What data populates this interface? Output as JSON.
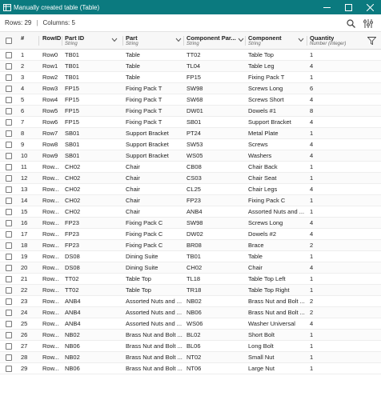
{
  "window": {
    "title": "Manually created table (Table)"
  },
  "toolbar": {
    "rows_label": "Rows: 29",
    "separator": "|",
    "columns_label": "Columns: 5"
  },
  "icons": {
    "app": "table-icon",
    "minimize": "minimize-icon",
    "maximize": "maximize-icon",
    "close": "close-icon",
    "search": "search-icon",
    "settings": "column-settings-icon",
    "filter": "filter-icon"
  },
  "columns": [
    {
      "name": "#",
      "type": ""
    },
    {
      "name": "RowID",
      "type": ""
    },
    {
      "name": "Part ID",
      "type": "String"
    },
    {
      "name": "Part",
      "type": "String"
    },
    {
      "name": "Component Par...",
      "type": "String"
    },
    {
      "name": "Component",
      "type": "String"
    },
    {
      "name": "Quantity",
      "type": "Number (integer)"
    }
  ],
  "rows": [
    [
      "1",
      "Row0",
      "TB01",
      "Table",
      "TT02",
      "Table Top",
      "1"
    ],
    [
      "2",
      "Row1",
      "TB01",
      "Table",
      "TL04",
      "Table Leg",
      "4"
    ],
    [
      "3",
      "Row2",
      "TB01",
      "Table",
      "FP15",
      "Fixing Pack T",
      "1"
    ],
    [
      "4",
      "Row3",
      "FP15",
      "Fixing Pack T",
      "SW98",
      "Screws Long",
      "6"
    ],
    [
      "5",
      "Row4",
      "FP15",
      "Fixing Pack T",
      "SW68",
      "Screws Short",
      "4"
    ],
    [
      "6",
      "Row5",
      "FP15",
      "Fixing Pack T",
      "DW01",
      "Dowels #1",
      "8"
    ],
    [
      "7",
      "Row6",
      "FP15",
      "Fixing Pack T",
      "SB01",
      "Support Bracket",
      "4"
    ],
    [
      "8",
      "Row7",
      "SB01",
      "Support Bracket",
      "PT24",
      "Metal Plate",
      "1"
    ],
    [
      "9",
      "Row8",
      "SB01",
      "Support Bracket",
      "SW53",
      "Screws",
      "4"
    ],
    [
      "10",
      "Row9",
      "SB01",
      "Support Bracket",
      "WS05",
      "Washers",
      "4"
    ],
    [
      "11",
      "Row...",
      "CH02",
      "Chair",
      "CB08",
      "Chair Back",
      "1"
    ],
    [
      "12",
      "Row...",
      "CH02",
      "Chair",
      "CS03",
      "Chair Seat",
      "1"
    ],
    [
      "13",
      "Row...",
      "CH02",
      "Chair",
      "CL25",
      "Chair Legs",
      "4"
    ],
    [
      "14",
      "Row...",
      "CH02",
      "Chair",
      "FP23",
      "Fixing Pack C",
      "1"
    ],
    [
      "15",
      "Row...",
      "CH02",
      "Chair",
      "ANB4",
      "Assorted Nuts and ...",
      "1"
    ],
    [
      "16",
      "Row...",
      "FP23",
      "Fixing Pack C",
      "SW98",
      "Screws Long",
      "4"
    ],
    [
      "17",
      "Row...",
      "FP23",
      "Fixing Pack C",
      "DW02",
      "Dowels #2",
      "4"
    ],
    [
      "18",
      "Row...",
      "FP23",
      "Fixing Pack C",
      "BR08",
      "Brace",
      "2"
    ],
    [
      "19",
      "Row...",
      "DS08",
      "Dining Suite",
      "TB01",
      "Table",
      "1"
    ],
    [
      "20",
      "Row...",
      "DS08",
      "Dining Suite",
      "CH02",
      "Chair",
      "4"
    ],
    [
      "21",
      "Row...",
      "TT02",
      "Table Top",
      "TL18",
      "Table Top Left",
      "1"
    ],
    [
      "22",
      "Row...",
      "TT02",
      "Table Top",
      "TR18",
      "Table Top Right",
      "1"
    ],
    [
      "23",
      "Row...",
      "ANB4",
      "Assorted Nuts and ...",
      "NB02",
      "Brass Nut and Bolt ...",
      "2"
    ],
    [
      "24",
      "Row...",
      "ANB4",
      "Assorted Nuts and ...",
      "NB06",
      "Brass Nut and Bolt ...",
      "2"
    ],
    [
      "25",
      "Row...",
      "ANB4",
      "Assorted Nuts and ...",
      "WS06",
      "Washer Universal",
      "4"
    ],
    [
      "26",
      "Row...",
      "NB02",
      "Brass Nut and Bolt ...",
      "BL02",
      "Short Bolt",
      "1"
    ],
    [
      "27",
      "Row...",
      "NB06",
      "Brass Nut and Bolt ...",
      "BL06",
      "Long Bolt",
      "1"
    ],
    [
      "28",
      "Row...",
      "NB02",
      "Brass Nut and Bolt ...",
      "NT02",
      "Small Nut",
      "1"
    ],
    [
      "29",
      "Row...",
      "NB06",
      "Brass Nut and Bolt ...",
      "NT06",
      "Large Nut",
      "1"
    ]
  ]
}
